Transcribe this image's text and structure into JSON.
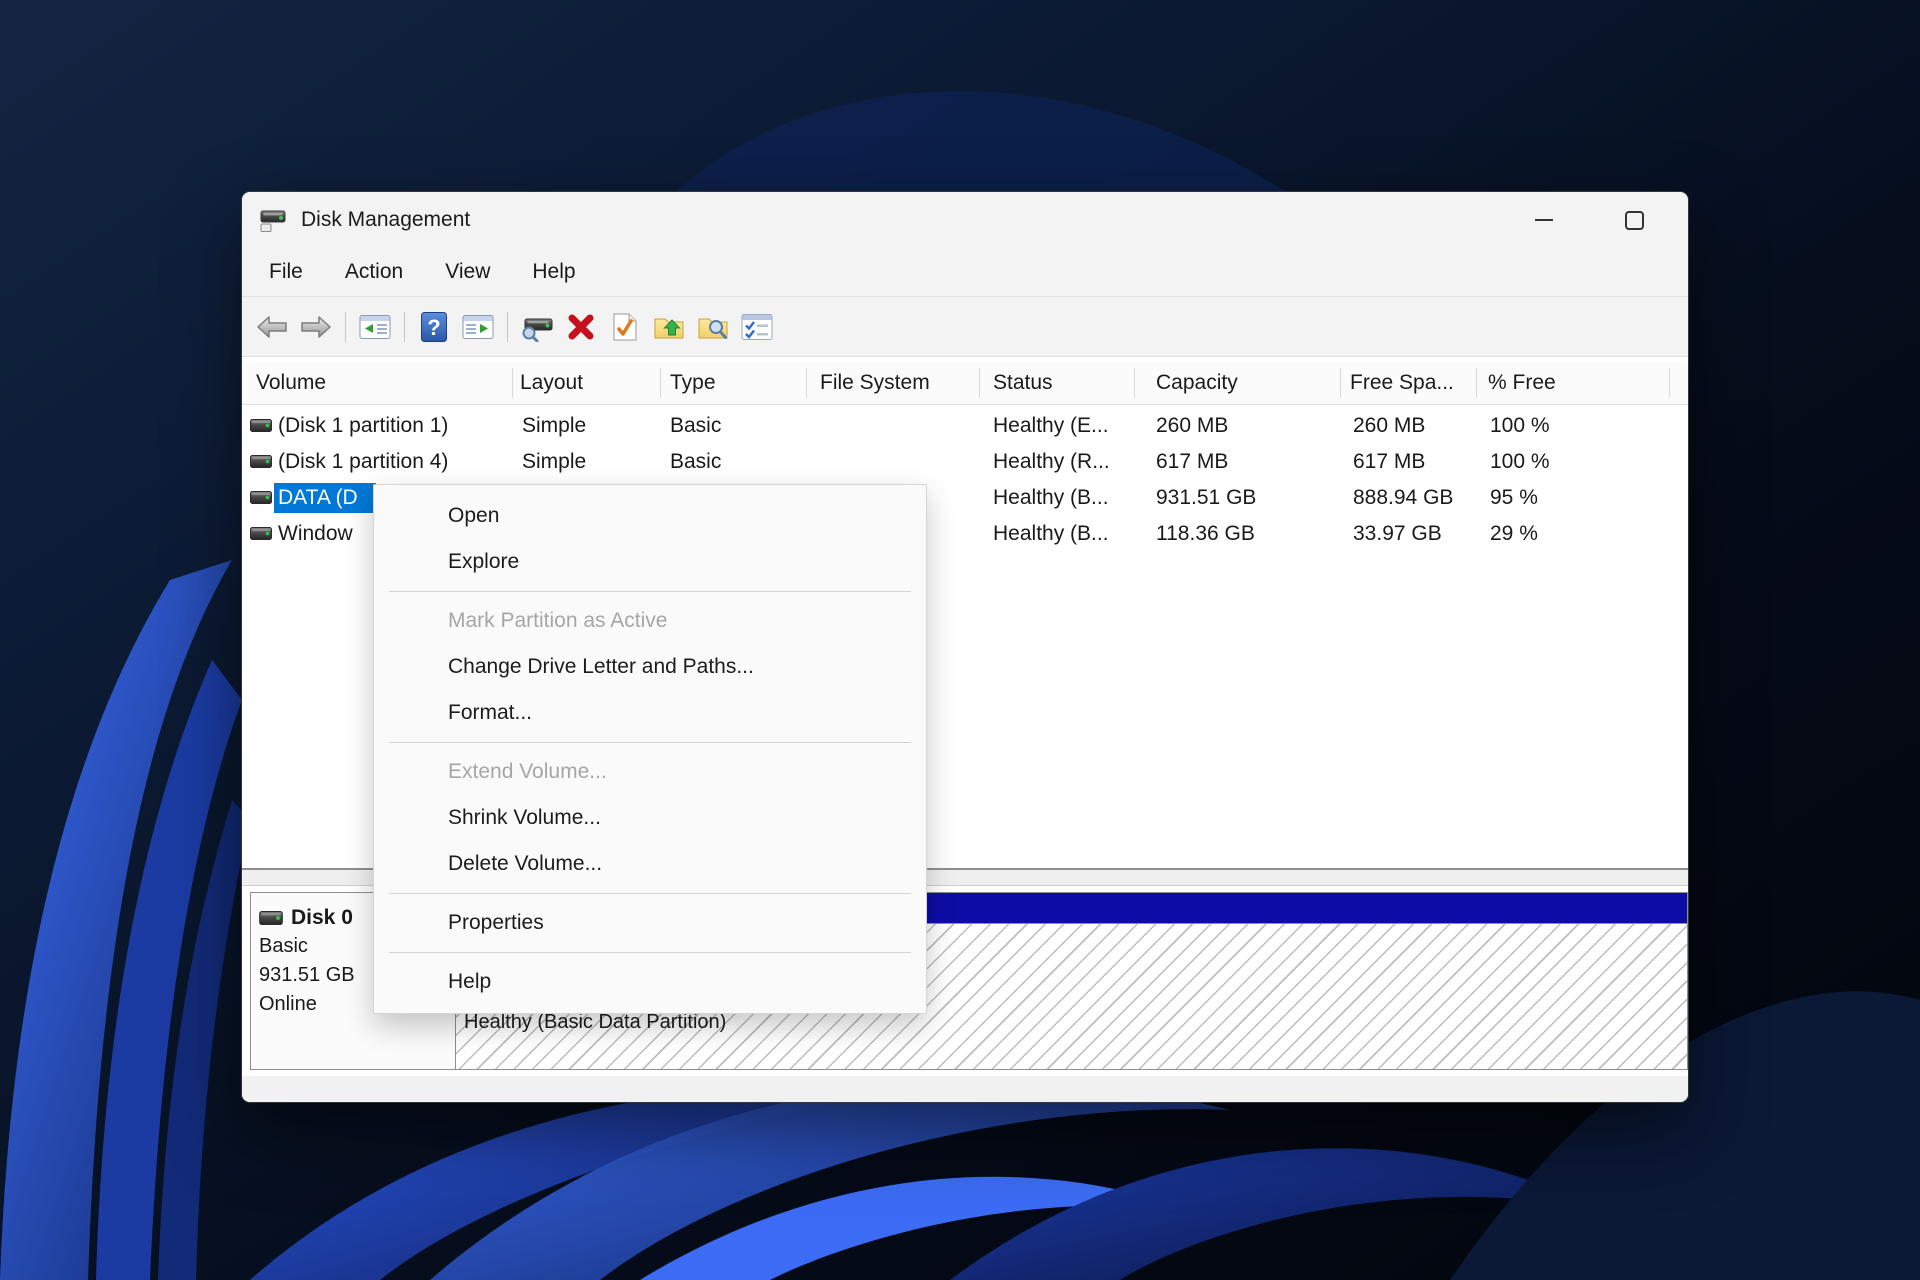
{
  "wallpaper": {
    "base_color": "#071223",
    "accent_color": "#2f5fe8"
  },
  "window": {
    "title": "Disk Management",
    "menu": {
      "items": [
        "File",
        "Action",
        "View",
        "Help"
      ]
    },
    "volume_table": {
      "columns": [
        "Volume",
        "Layout",
        "Type",
        "File System",
        "Status",
        "Capacity",
        "Free Spa...",
        "% Free"
      ],
      "rows": [
        {
          "volume": "(Disk 1 partition 1)",
          "layout": "Simple",
          "type": "Basic",
          "file_system": "",
          "status": "Healthy (E...",
          "capacity": "260 MB",
          "free_space": "260 MB",
          "pct_free": "100 %",
          "selected": false
        },
        {
          "volume": "(Disk 1 partition 4)",
          "layout": "Simple",
          "type": "Basic",
          "file_system": "",
          "status": "Healthy (R...",
          "capacity": "617 MB",
          "free_space": "617 MB",
          "pct_free": "100 %",
          "selected": false
        },
        {
          "volume": "DATA (D",
          "layout": "",
          "type": "",
          "file_system": "",
          "status": "Healthy (B...",
          "capacity": "931.51 GB",
          "free_space": "888.94 GB",
          "pct_free": "95 %",
          "selected": true
        },
        {
          "volume": "Window",
          "layout": "",
          "type": "",
          "file_system": "",
          "status": "Healthy (B...",
          "capacity": "118.36 GB",
          "free_space": "33.97 GB",
          "pct_free": "29 %",
          "selected": false
        }
      ]
    },
    "graphical_view": {
      "disk": {
        "name": "Disk 0",
        "type": "Basic",
        "size": "931.51 GB",
        "status": "Online"
      },
      "partition": {
        "label": "Healthy (Basic Data Partition)",
        "stripe_color": "#0d0da6"
      }
    }
  },
  "context_menu": {
    "groups": [
      {
        "items": [
          {
            "label": "Open",
            "enabled": true
          },
          {
            "label": "Explore",
            "enabled": true
          }
        ]
      },
      {
        "items": [
          {
            "label": "Mark Partition as Active",
            "enabled": false
          },
          {
            "label": "Change Drive Letter and Paths...",
            "enabled": true
          },
          {
            "label": "Format...",
            "enabled": true
          }
        ]
      },
      {
        "items": [
          {
            "label": "Extend Volume...",
            "enabled": false
          },
          {
            "label": "Shrink Volume...",
            "enabled": true
          },
          {
            "label": "Delete Volume...",
            "enabled": true
          }
        ]
      },
      {
        "items": [
          {
            "label": "Properties",
            "enabled": true
          }
        ]
      },
      {
        "items": [
          {
            "label": "Help",
            "enabled": true
          }
        ]
      }
    ]
  },
  "colors": {
    "selection": "#0078d7",
    "partition_stripe": "#0d0da6",
    "disabled_text": "#a6a6a6"
  },
  "icons": {
    "titlebar": "disk-drive-icon",
    "help_glyph": "?",
    "window_controls": [
      "minimize-icon",
      "maximize-icon"
    ],
    "toolbar": [
      "back-icon",
      "forward-icon",
      "show-console-tree-icon",
      "help-icon",
      "show-action-pane-icon",
      "rescan-disks-icon",
      "delete-volume-icon",
      "mark-partition-active-icon",
      "open-folder-icon",
      "explore-folder-icon",
      "checklist-icon"
    ],
    "volume_row": "disk-drive-icon"
  }
}
